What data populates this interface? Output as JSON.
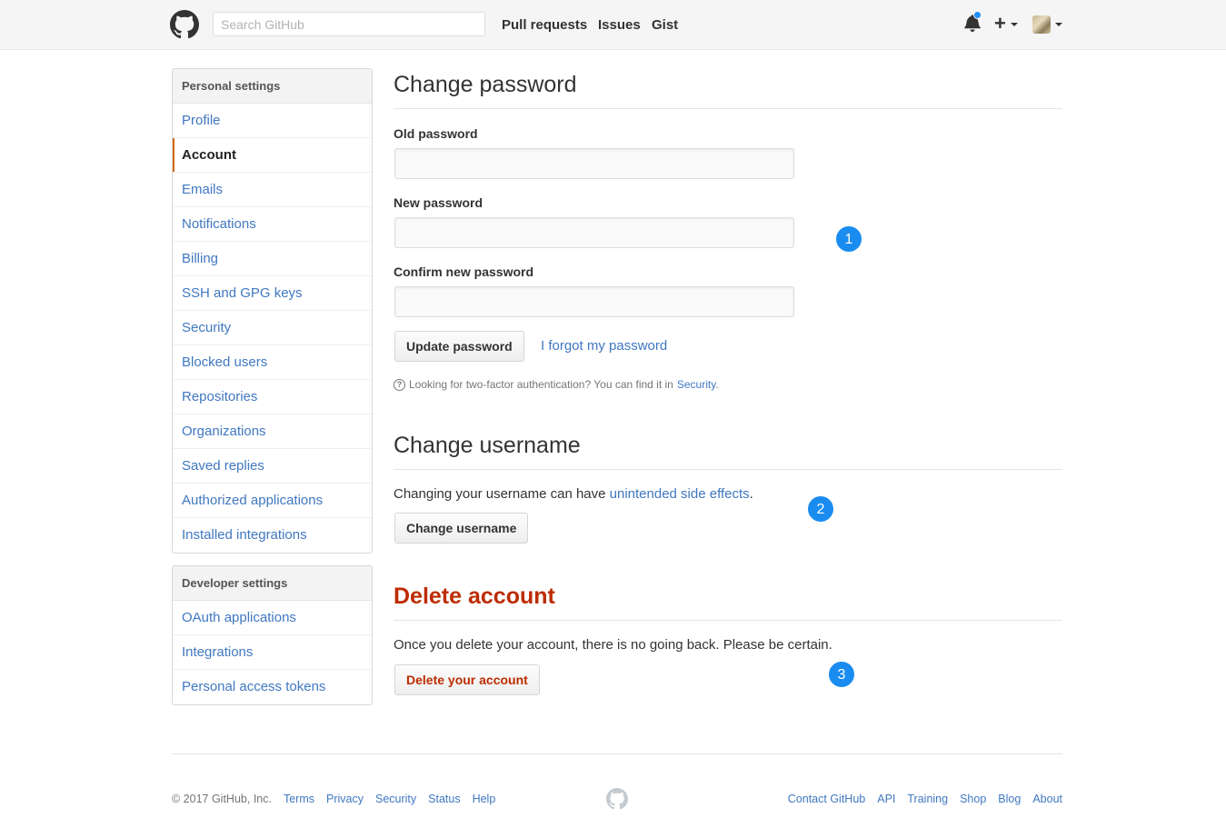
{
  "header": {
    "search_placeholder": "Search GitHub",
    "nav": [
      "Pull requests",
      "Issues",
      "Gist"
    ],
    "plus_label": "+"
  },
  "sidebar": {
    "personal_heading": "Personal settings",
    "personal_items": [
      "Profile",
      "Account",
      "Emails",
      "Notifications",
      "Billing",
      "SSH and GPG keys",
      "Security",
      "Blocked users",
      "Repositories",
      "Organizations",
      "Saved replies",
      "Authorized applications",
      "Installed integrations"
    ],
    "selected": "Account",
    "developer_heading": "Developer settings",
    "developer_items": [
      "OAuth applications",
      "Integrations",
      "Personal access tokens"
    ]
  },
  "change_password": {
    "title": "Change password",
    "old_label": "Old password",
    "new_label": "New password",
    "confirm_label": "Confirm new password",
    "update_button": "Update password",
    "forgot_link": "I forgot my password",
    "note_prefix": "Looking for two-factor authentication? You can find it in",
    "note_link": "Security",
    "note_suffix": "."
  },
  "change_username": {
    "title": "Change username",
    "text_prefix": "Changing your username can have",
    "text_link": "unintended side effects",
    "text_suffix": ".",
    "button": "Change username"
  },
  "delete_account": {
    "title": "Delete account",
    "text": "Once you delete your account, there is no going back. Please be certain.",
    "button": "Delete your account"
  },
  "markers": [
    "1",
    "2",
    "3"
  ],
  "footer": {
    "copyright": "© 2017 GitHub, Inc.",
    "left_links": [
      "Terms",
      "Privacy",
      "Security",
      "Status",
      "Help"
    ],
    "right_links": [
      "Contact GitHub",
      "API",
      "Training",
      "Shop",
      "Blog",
      "About"
    ]
  },
  "colors": {
    "link": "#4078c0",
    "danger": "#bd2c00",
    "marker": "#1a8cf0",
    "selected_accent": "#d26911"
  }
}
